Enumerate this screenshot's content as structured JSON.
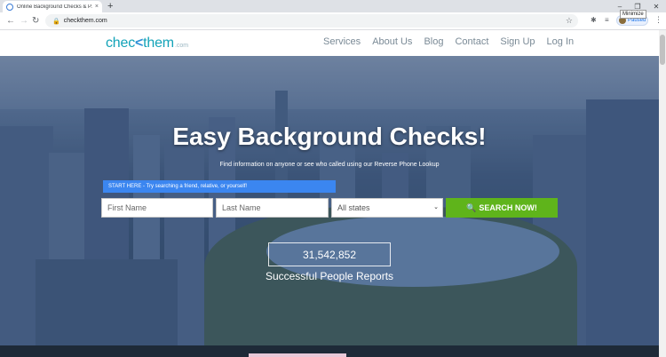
{
  "browser": {
    "tab_title": "Online Background Checks & P...",
    "tab_close": "×",
    "new_tab": "+",
    "window_min": "–",
    "window_max": "❐",
    "window_close": "✕",
    "url": "checkthem.com",
    "profile_status": "Paused",
    "tooltip": "Minimize",
    "icons": {
      "back": "←",
      "forward": "→",
      "reload": "↻",
      "lock": "🔒",
      "star": "☆",
      "extensions": "✱",
      "media": "≡",
      "menu": "⋮"
    }
  },
  "site": {
    "logo_main_a": "chec",
    "logo_main_x": "<",
    "logo_main_b": "them",
    "logo_suffix": ".com",
    "nav": {
      "services": "Services",
      "about": "About Us",
      "blog": "Blog",
      "contact": "Contact",
      "signup": "Sign Up",
      "login": "Log In"
    }
  },
  "hero": {
    "title": "Easy Background Checks!",
    "subtitle": "Find information on anyone or see who called using our Reverse Phone Lookup",
    "start_banner": "START HERE - Try searching a friend, relative, or yourself!",
    "first_name_placeholder": "First Name",
    "last_name_placeholder": "Last Name",
    "state_selected": "All states",
    "state_arrow": "⌄",
    "search_button": "SEARCH NOW!",
    "search_icon_glyph": "🔍",
    "stat_count": "31,542,852",
    "stat_label": "Successful People Reports"
  },
  "colors": {
    "brand_teal": "#13a3b8",
    "search_green": "#5fb41b",
    "banner_blue": "#3b86f0"
  }
}
